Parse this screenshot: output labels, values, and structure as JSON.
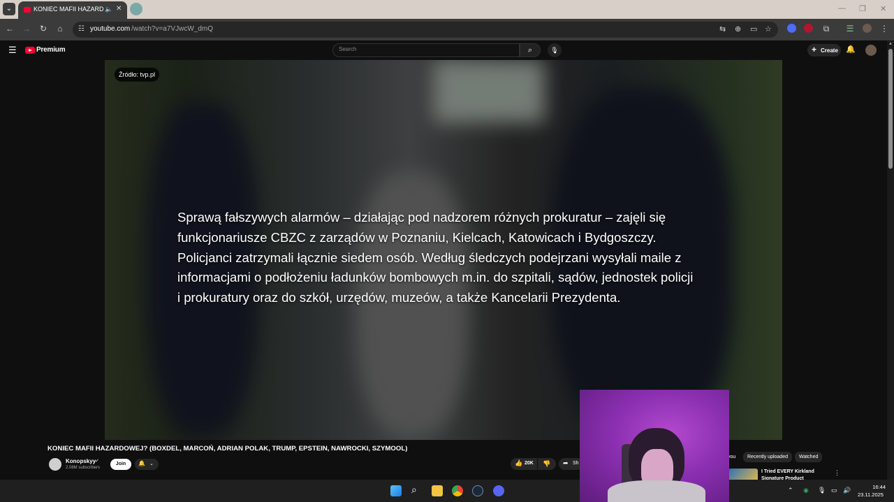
{
  "browser": {
    "tab": {
      "title": "KONIEC MAFII HAZARDOW",
      "audio_icon": "speaker-icon",
      "close": "✕"
    },
    "url": {
      "host": "youtube.com",
      "path": "/watch?v=a7VJwcW_dmQ"
    },
    "window_controls": {
      "minimize": "—",
      "maximize": "❐",
      "close": "✕"
    }
  },
  "youtube": {
    "logo_text": "Premium",
    "search": {
      "placeholder": "Search"
    },
    "create_label": "Create",
    "brand_color": "#ff0033"
  },
  "video": {
    "source_badge": "Źródło: tvp.pl",
    "caption": "Sprawą fałszywych alarmów – działając pod nadzorem różnych prokuratur – zajęli się funkcjonariusze CBZC z zarządów w Poznaniu, Kielcach, Katowicach i Bydgoszczy. Policjanci zatrzymali łącznie siedem osób. Według śledczych podejrzani wysyłali maile z informacjami o podłożeniu ładunków bombowych m.in. do szpitali, sądów, jednostek policji i prokuratury oraz do szkół, urzędów, muzeów, a także Kancelarii Prezydenta.",
    "title": "KONIEC MAFII HAZARDOWEJ? (BOXDEL, MARCOŃ, ADRIAN POLAK, TRUMP, EPSTEIN, NAWROCKI, SZYMOOL)",
    "channel": {
      "name": "Konopskyy",
      "subscribers": "2.08M subscribers"
    },
    "join_label": "Join",
    "like_count": "20K",
    "share_label": "Sh"
  },
  "sidebar": {
    "chips": [
      "you",
      "Recently uploaded",
      "Watched"
    ],
    "recommendation": {
      "title": "I Tried EVERY Kirkland Signature Product"
    }
  },
  "taskbar": {
    "time": "16:44",
    "date": "23.11.2025"
  }
}
